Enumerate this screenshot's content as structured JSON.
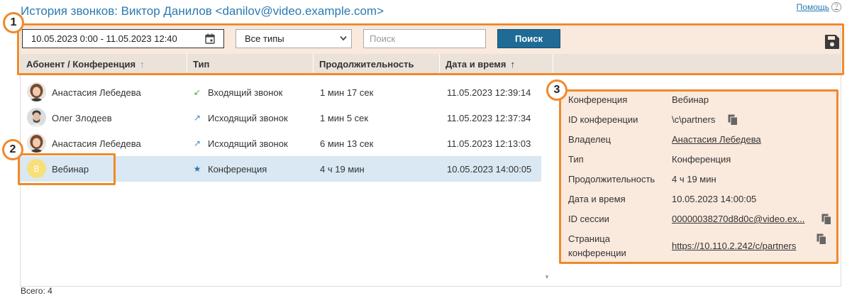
{
  "page": {
    "title": "История звонков: Виктор Данилов <danilov@video.example.com>",
    "help_label": "Помощь",
    "help_icon": "?"
  },
  "toolbar": {
    "date_range": "10.05.2023 0:00 - 11.05.2023 12:40",
    "type_select": "Все типы",
    "search_placeholder": "Поиск",
    "search_button": "Поиск"
  },
  "table": {
    "columns": [
      "Абонент / Конференция",
      "Тип",
      "Продолжительность",
      "Дата и время"
    ],
    "sort_indicators": [
      "↑",
      "↑"
    ],
    "rows": [
      {
        "name": "Анастасия Лебедева",
        "type": "Входящий звонок",
        "type_icon": "↙",
        "duration": "1 мин 17 сек",
        "datetime": "11.05.2023 12:39:14"
      },
      {
        "name": "Олег Злодеев",
        "type": "Исходящий звонок",
        "type_icon": "↗",
        "duration": "1 мин 5 сек",
        "datetime": "11.05.2023 12:37:34"
      },
      {
        "name": "Анастасия Лебедева",
        "type": "Исходящий звонок",
        "type_icon": "↗",
        "duration": "6 мин 13 сек",
        "datetime": "11.05.2023 12:13:03"
      },
      {
        "name": "Вебинар",
        "avatar_letter": "В",
        "type": "Конференция",
        "type_icon": "★",
        "duration": "4 ч 19 мин",
        "datetime": "10.05.2023 14:00:05"
      }
    ],
    "total": "Всего: 4"
  },
  "details": {
    "fields": [
      {
        "label": "Конференция",
        "value": "Вебинар"
      },
      {
        "label": "ID конференции",
        "value": "\\c\\partners"
      },
      {
        "label": "Владелец",
        "value": "Анастасия Лебедева"
      },
      {
        "label": "Тип",
        "value": "Конференция"
      },
      {
        "label": "Продолжительность",
        "value": "4 ч 19 мин"
      },
      {
        "label": "Дата и время",
        "value": "10.05.2023 14:00:05"
      },
      {
        "label": "ID сессии",
        "value": "00000038270d8d0c@video.ex..."
      },
      {
        "label": "Страница конференции",
        "value": "https://10.110.2.242/c/partners"
      }
    ]
  },
  "callouts": [
    "1",
    "2",
    "3"
  ],
  "colors": {
    "accent": "#f0892b",
    "title": "#2a7ab0",
    "button": "#1f6b96",
    "selected_row": "#d9e8f3",
    "details_bg": "#fae9dd"
  }
}
